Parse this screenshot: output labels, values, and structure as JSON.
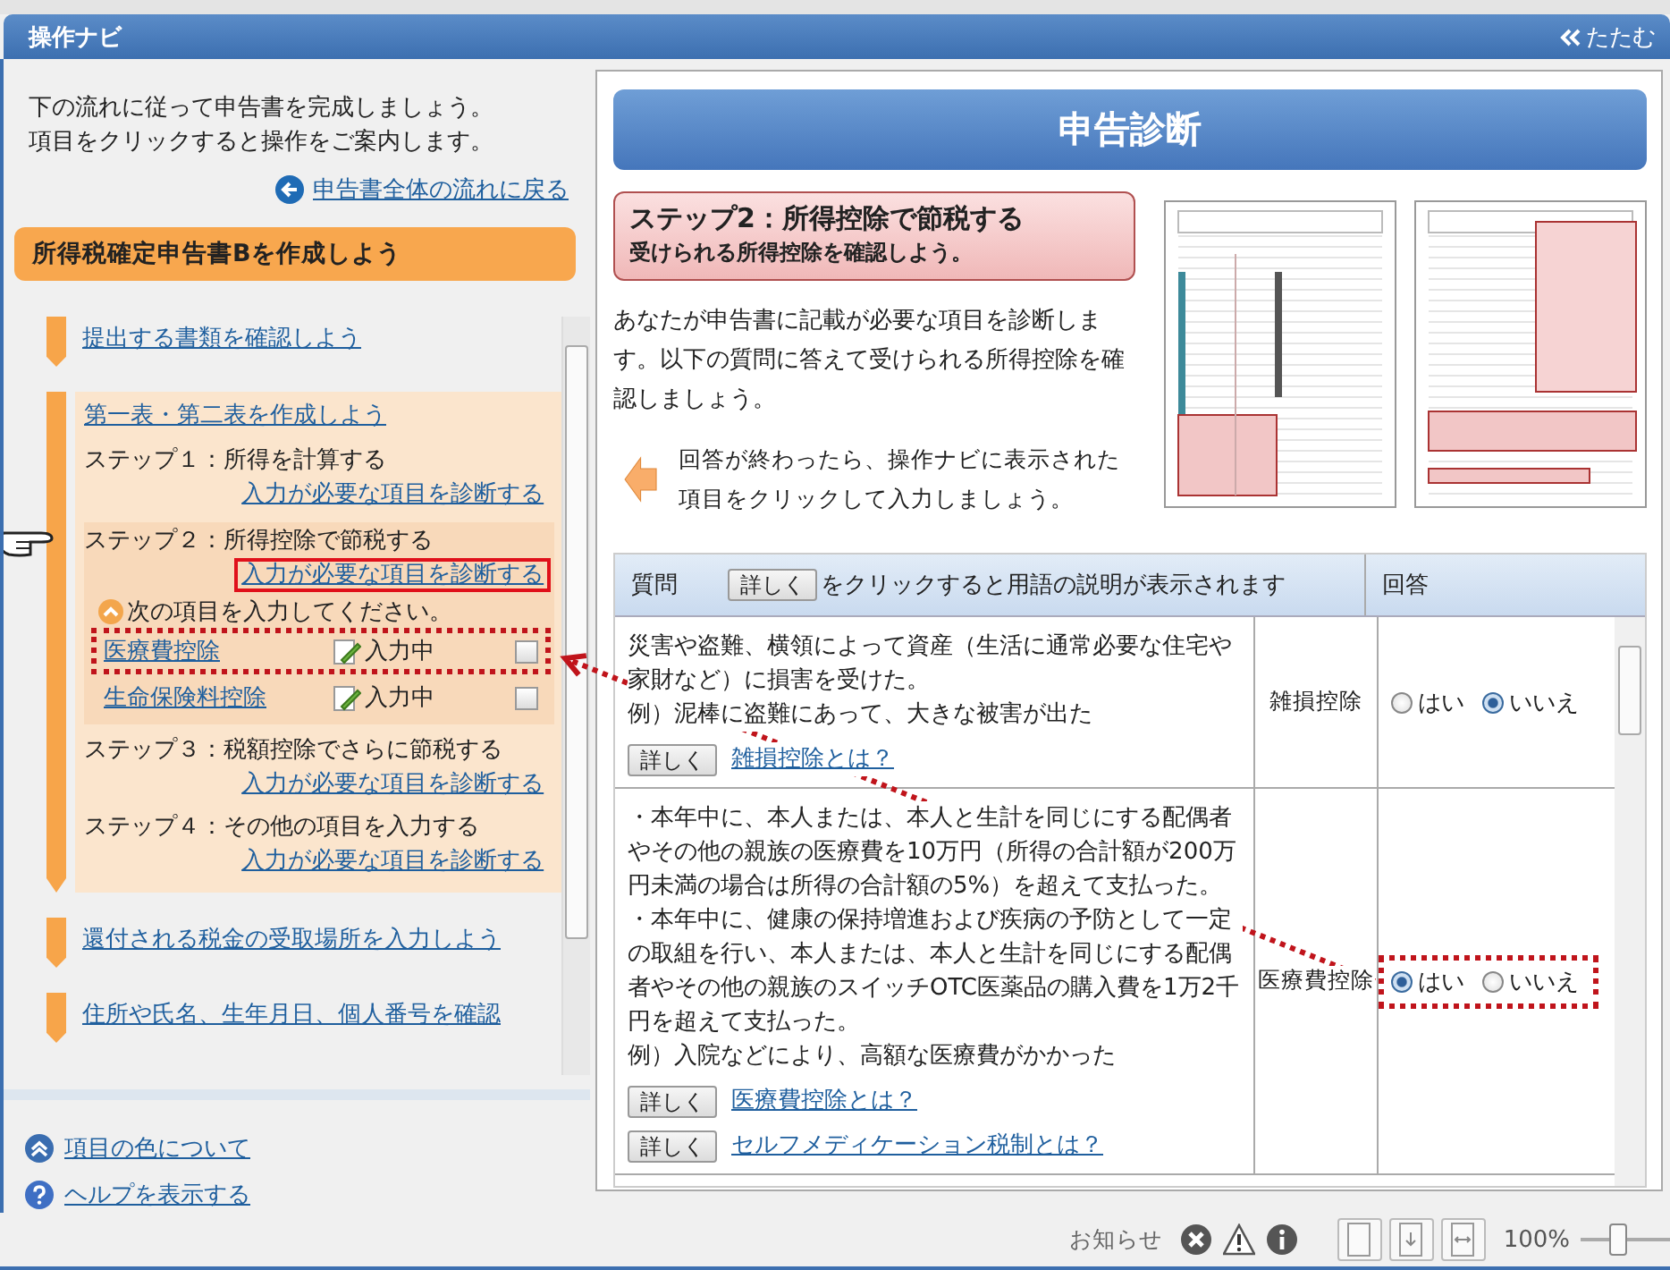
{
  "app_bar": {
    "title": "操作ナビ",
    "collapse_label": "たたむ"
  },
  "navi": {
    "intro": [
      "下の流れに従って申告書を完成しましょう。",
      "項目をクリックすると操作をご案内します。"
    ],
    "back_link": "申告書全体の流れに戻る",
    "form_title": "所得税確定申告書Bを作成しよう",
    "flow": [
      {
        "title": "提出する書類を確認しよう",
        "expanded": false
      },
      {
        "title": "第一表・第二表を作成しよう",
        "expanded": true,
        "steps": [
          {
            "label": "ステップ１：所得を計算する",
            "link": "入力が必要な項目を診断する",
            "current": false,
            "link_marked": false
          },
          {
            "label": "ステップ２：所得控除で節税する",
            "link": "入力が必要な項目を診断する",
            "current": true,
            "link_marked": true,
            "notice": "次の項目を入力してください。",
            "items": [
              {
                "name": "医療費控除",
                "status": "入力中",
                "checked": false,
                "marked": true
              },
              {
                "name": "生命保険料控除",
                "status": "入力中",
                "checked": false,
                "marked": false
              }
            ]
          },
          {
            "label": "ステップ３：税額控除でさらに節税する",
            "link": "入力が必要な項目を診断する",
            "current": false,
            "link_marked": false
          },
          {
            "label": "ステップ４：その他の項目を入力する",
            "link": "入力が必要な項目を診断する",
            "current": false,
            "link_marked": false
          }
        ]
      },
      {
        "title": "還付される税金の受取場所を入力しよう",
        "expanded": false
      },
      {
        "title": "住所や氏名、生年月日、個人番号を確認",
        "expanded": false
      }
    ],
    "footer_links": [
      {
        "kind": "colors",
        "label": "項目の色について"
      },
      {
        "kind": "help",
        "label": "ヘルプを表示する"
      }
    ]
  },
  "diagnosis": {
    "title": "申告診断",
    "step_title": "ステップ2：所得控除で節税する",
    "step_subtitle": "受けられる所得控除を確認しよう。",
    "description": "あなたが申告書に記載が必要な項目を診断します。以下の質問に答えて受けられる所得控除を確認しましょう。",
    "instruction": "回答が終わったら、操作ナビに表示された項目をクリックして入力しましょう。",
    "table": {
      "question_header": "質問",
      "header_button": "詳しく",
      "header_hint": "をクリックすると用語の説明が表示されます",
      "answer_header": "回答",
      "rows": [
        {
          "question": [
            "災害や盗難、横領によって資産（生活に通常必要な住宅や家財など）に損害を受けた。",
            "例）泥棒に盗難にあって、大きな被害が出た"
          ],
          "links": [
            {
              "button": "詳しく",
              "label": "雑損控除とは？"
            }
          ],
          "deduction": "雑損控除",
          "marked": false,
          "answers": [
            {
              "label": "はい",
              "selected": false
            },
            {
              "label": "いいえ",
              "selected": true
            }
          ]
        },
        {
          "question": [
            "・本年中に、本人または、本人と生計を同じにする配偶者やその他の親族の医療費を10万円（所得の合計額が200万円未満の場合は所得の合計額の5%）を超えて支払った。",
            "・本年中に、健康の保持増進および疾病の予防として一定の取組を行い、本人または、本人と生計を同じにする配偶者やその他の親族のスイッチOTC医薬品の購入費を1万2千円を超えて支払った。",
            "例）入院などにより、高額な医療費がかかった"
          ],
          "links": [
            {
              "button": "詳しく",
              "label": "医療費控除とは？"
            },
            {
              "button": "詳しく",
              "label": "セルフメディケーション税制とは？"
            }
          ],
          "deduction": "医療費控除",
          "marked": true,
          "answers": [
            {
              "label": "はい",
              "selected": true
            },
            {
              "label": "いいえ",
              "selected": false
            }
          ]
        }
      ]
    }
  },
  "status_bar": {
    "notice_label": "お知らせ",
    "zoom": "100%",
    "zoom_slider": {
      "level": 0.4
    }
  }
}
